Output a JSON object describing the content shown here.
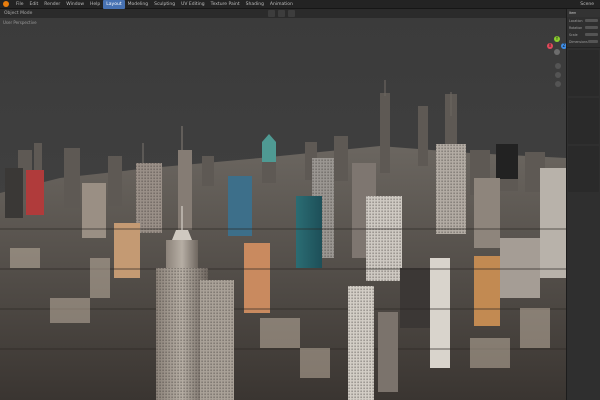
{
  "menu": {
    "items": [
      "File",
      "Edit",
      "Render",
      "Window",
      "Help",
      "Layout",
      "Modeling",
      "Sculpting",
      "UV Editing",
      "Texture Paint",
      "Shading",
      "Animation"
    ],
    "active_index": 5,
    "scene_name": "Scene"
  },
  "viewport": {
    "mode_label": "Object Mode",
    "overlay_label": "User Perspective",
    "background_color": "#3b3b3b"
  },
  "gizmo": {
    "x": "X",
    "y": "Y",
    "z": "Z"
  },
  "sidebar": {
    "title": "Item",
    "rows": [
      "Location",
      "Rotation",
      "Scale",
      "Dimensions"
    ],
    "panels": 3
  },
  "colors": {
    "accent": "#e87d0d",
    "active_menu": "#4772b3",
    "axis_x": "#e44a5c",
    "axis_y": "#8ccf2f",
    "axis_z": "#3f8de6"
  },
  "icons": [
    "blender-logo-icon",
    "move-tool-icon",
    "snap-icon",
    "proportional-icon",
    "zoom-icon",
    "pan-icon",
    "camera-view-icon"
  ]
}
